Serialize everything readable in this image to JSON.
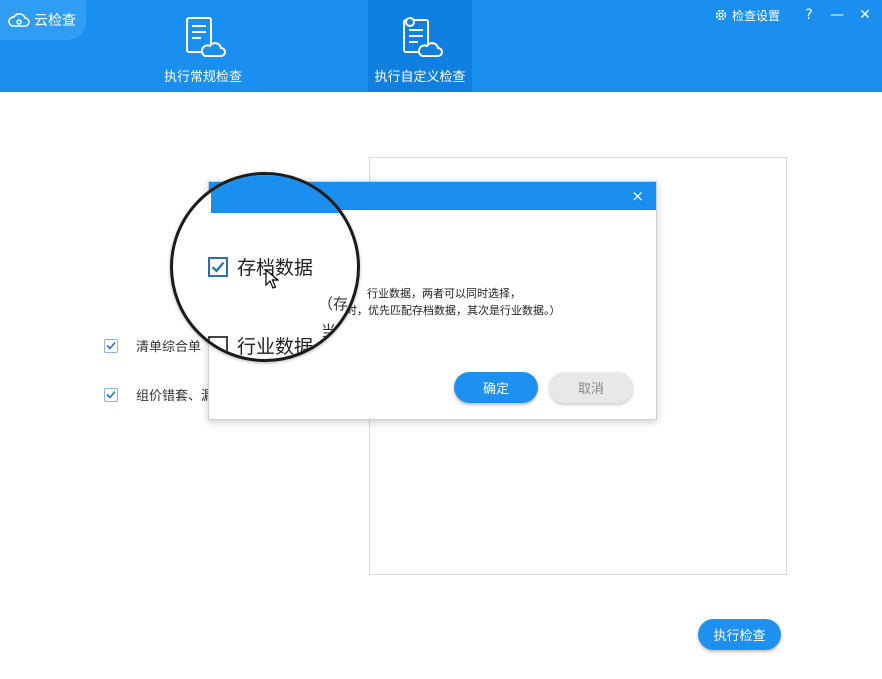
{
  "app": {
    "title": "云检查"
  },
  "header": {
    "tabs": [
      {
        "label": "执行常规检查",
        "active": false
      },
      {
        "label": "执行自定义检查",
        "active": true
      }
    ],
    "settings_label": "检查设置",
    "help": "?",
    "minimize": "—",
    "close": "✕"
  },
  "main": {
    "options": [
      {
        "label": "清单综合单",
        "checked": true
      },
      {
        "label": "组价错套、漏",
        "checked": true
      }
    ],
    "run_button": "执行检查"
  },
  "dialog": {
    "close": "×",
    "text_line1": "行业数据，两者可以同时选择，",
    "text_line2": "时，优先匹配存档数据，其次是行业数据。）",
    "ok": "确定",
    "cancel": "取消"
  },
  "magnifier": {
    "option1": {
      "label": "存档数据",
      "checked": true
    },
    "option2": {
      "label": "行业数据",
      "checked": false
    },
    "paren_text": "（存",
    "dang_text": "当"
  },
  "colors": {
    "primary": "#1a8ff0",
    "active_tab": "#0f7fe0",
    "cancel_bg": "#e8e8e8"
  }
}
